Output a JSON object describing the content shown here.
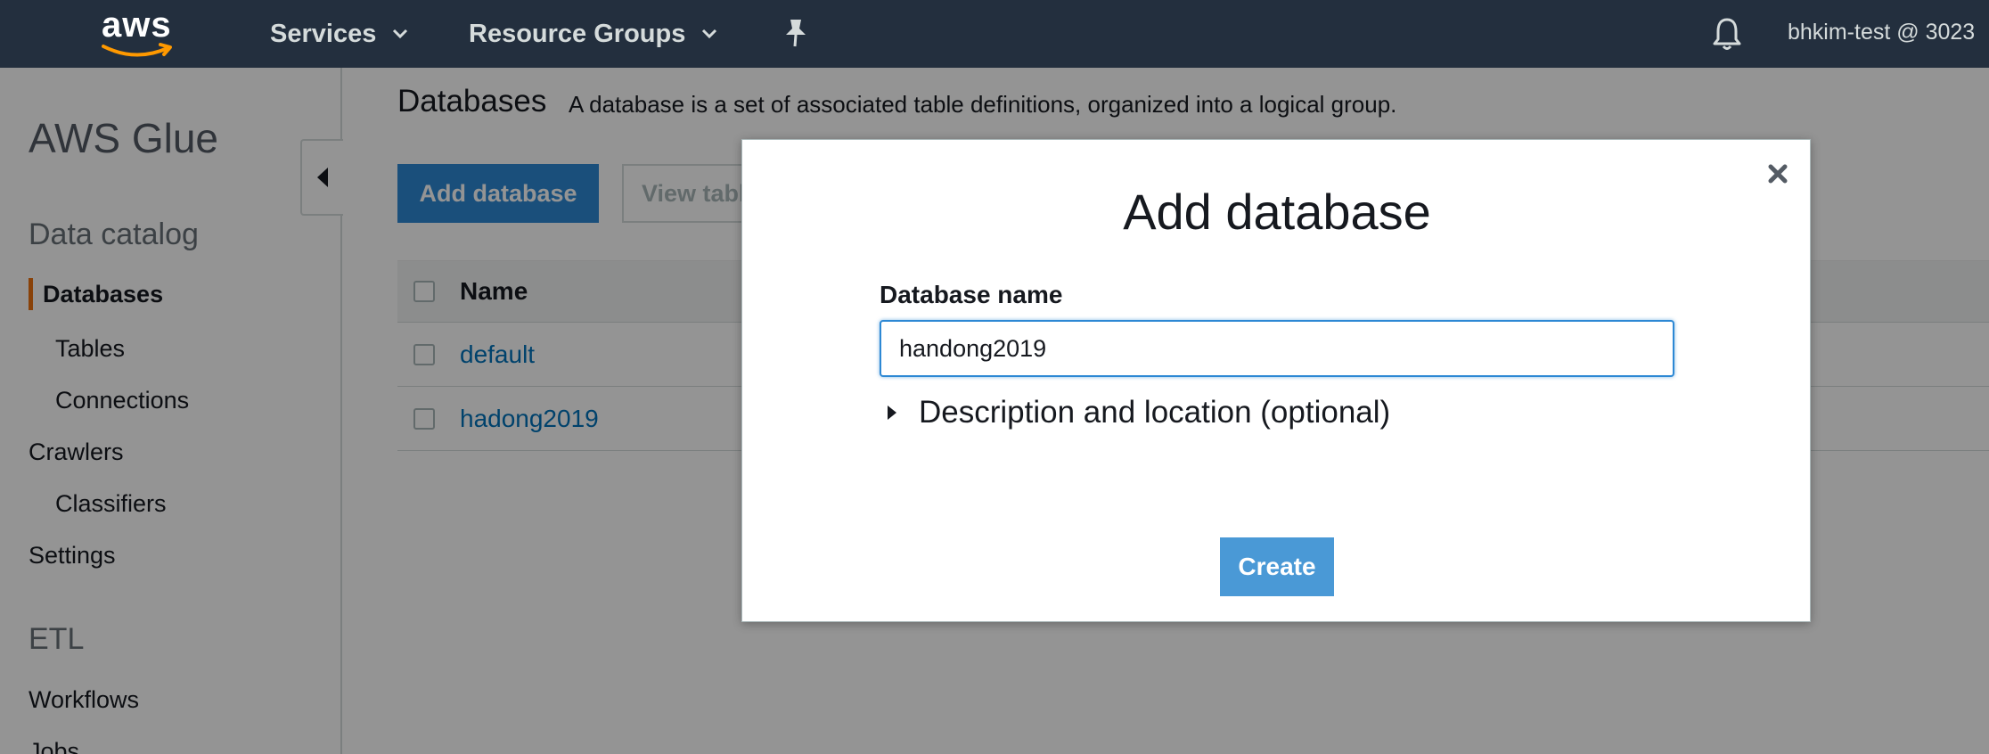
{
  "topnav": {
    "logo_text": "aws",
    "services_label": "Services",
    "resource_groups_label": "Resource Groups",
    "account_label": "bhkim-test @ 3023"
  },
  "sidebar": {
    "title": "AWS Glue",
    "section_data_catalog": "Data catalog",
    "items": {
      "databases": "Databases",
      "tables": "Tables",
      "connections": "Connections",
      "crawlers": "Crawlers",
      "classifiers": "Classifiers",
      "settings": "Settings"
    },
    "section_etl": "ETL",
    "etl_items": {
      "workflows": "Workflows",
      "jobs": "Jobs"
    },
    "active_item": "Databases"
  },
  "main": {
    "title": "Databases",
    "description": "A database is a set of associated table definitions, organized into a logical group.",
    "add_database_label": "Add database",
    "view_tables_label": "View tables",
    "table": {
      "header_name": "Name",
      "rows": [
        "default",
        "hadong2019"
      ]
    }
  },
  "modal": {
    "title": "Add database",
    "field_label": "Database name",
    "field_value": "handong2019",
    "disclosure_label": "Description and location (optional)",
    "create_label": "Create"
  },
  "colors": {
    "nav_bg": "#232f3e",
    "primary_button": "#2d88d4",
    "active_marker": "#ec7211",
    "link": "#0073bb"
  },
  "icons": [
    "chevron-down-icon",
    "pin-icon",
    "bell-icon",
    "collapse-left-icon",
    "close-icon",
    "caret-right-icon",
    "aws-smile-icon"
  ]
}
